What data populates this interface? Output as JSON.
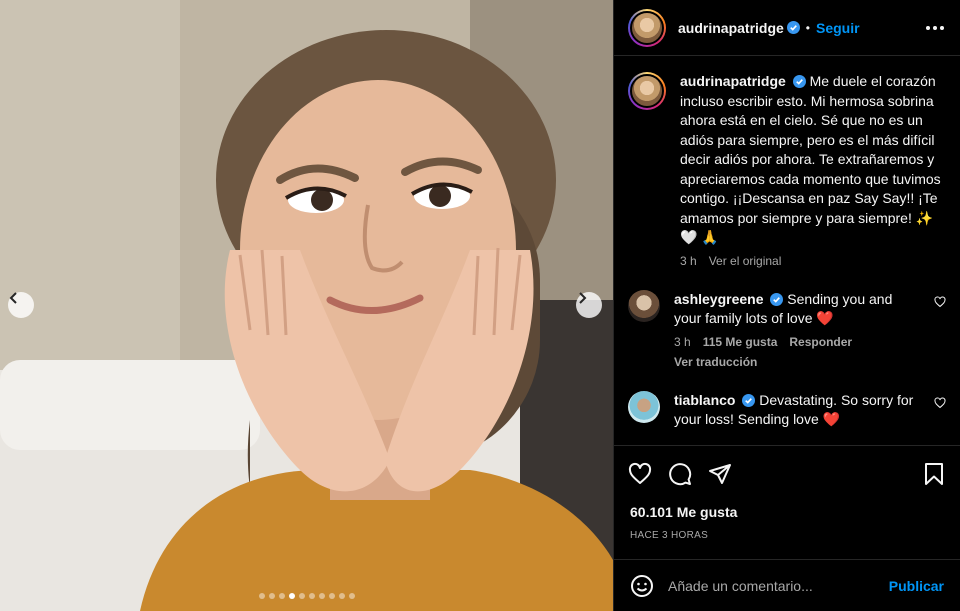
{
  "post": {
    "username": "audrinapatridge",
    "follow_label": "Seguir",
    "caption": "Me duele el corazón incluso escribir esto. Mi hermosa sobrina ahora está en el cielo. Sé que no es un adiós para siempre, pero es el más difícil decir adiós por ahora. Te extrañaremos y apreciaremos cada momento que tuvimos contigo. ¡¡Descansa en paz Say Say!! ¡Te amamos por siempre y para siempre! ✨ 🤍 🙏",
    "caption_time": "3 h",
    "see_original": "Ver el original",
    "likes": "60.101 Me gusta",
    "posted_ago": "HACE 3 HORAS"
  },
  "comments": [
    {
      "username": "ashleygreene",
      "text": "Sending you and your family lots of love ❤️",
      "time": "3 h",
      "likes": "115 Me gusta",
      "reply": "Responder",
      "translate": "Ver traducción"
    },
    {
      "username": "tiablanco",
      "text": "Devastating. So sorry for your loss! Sending love ❤️"
    }
  ],
  "composer": {
    "placeholder": "Añade un comentario...",
    "publish_label": "Publicar"
  },
  "carousel": {
    "slide_count": 10,
    "active_index": 3
  },
  "colors": {
    "accent": "#0095f6",
    "verified": "#3897f0",
    "like_red": "#ed4956"
  }
}
